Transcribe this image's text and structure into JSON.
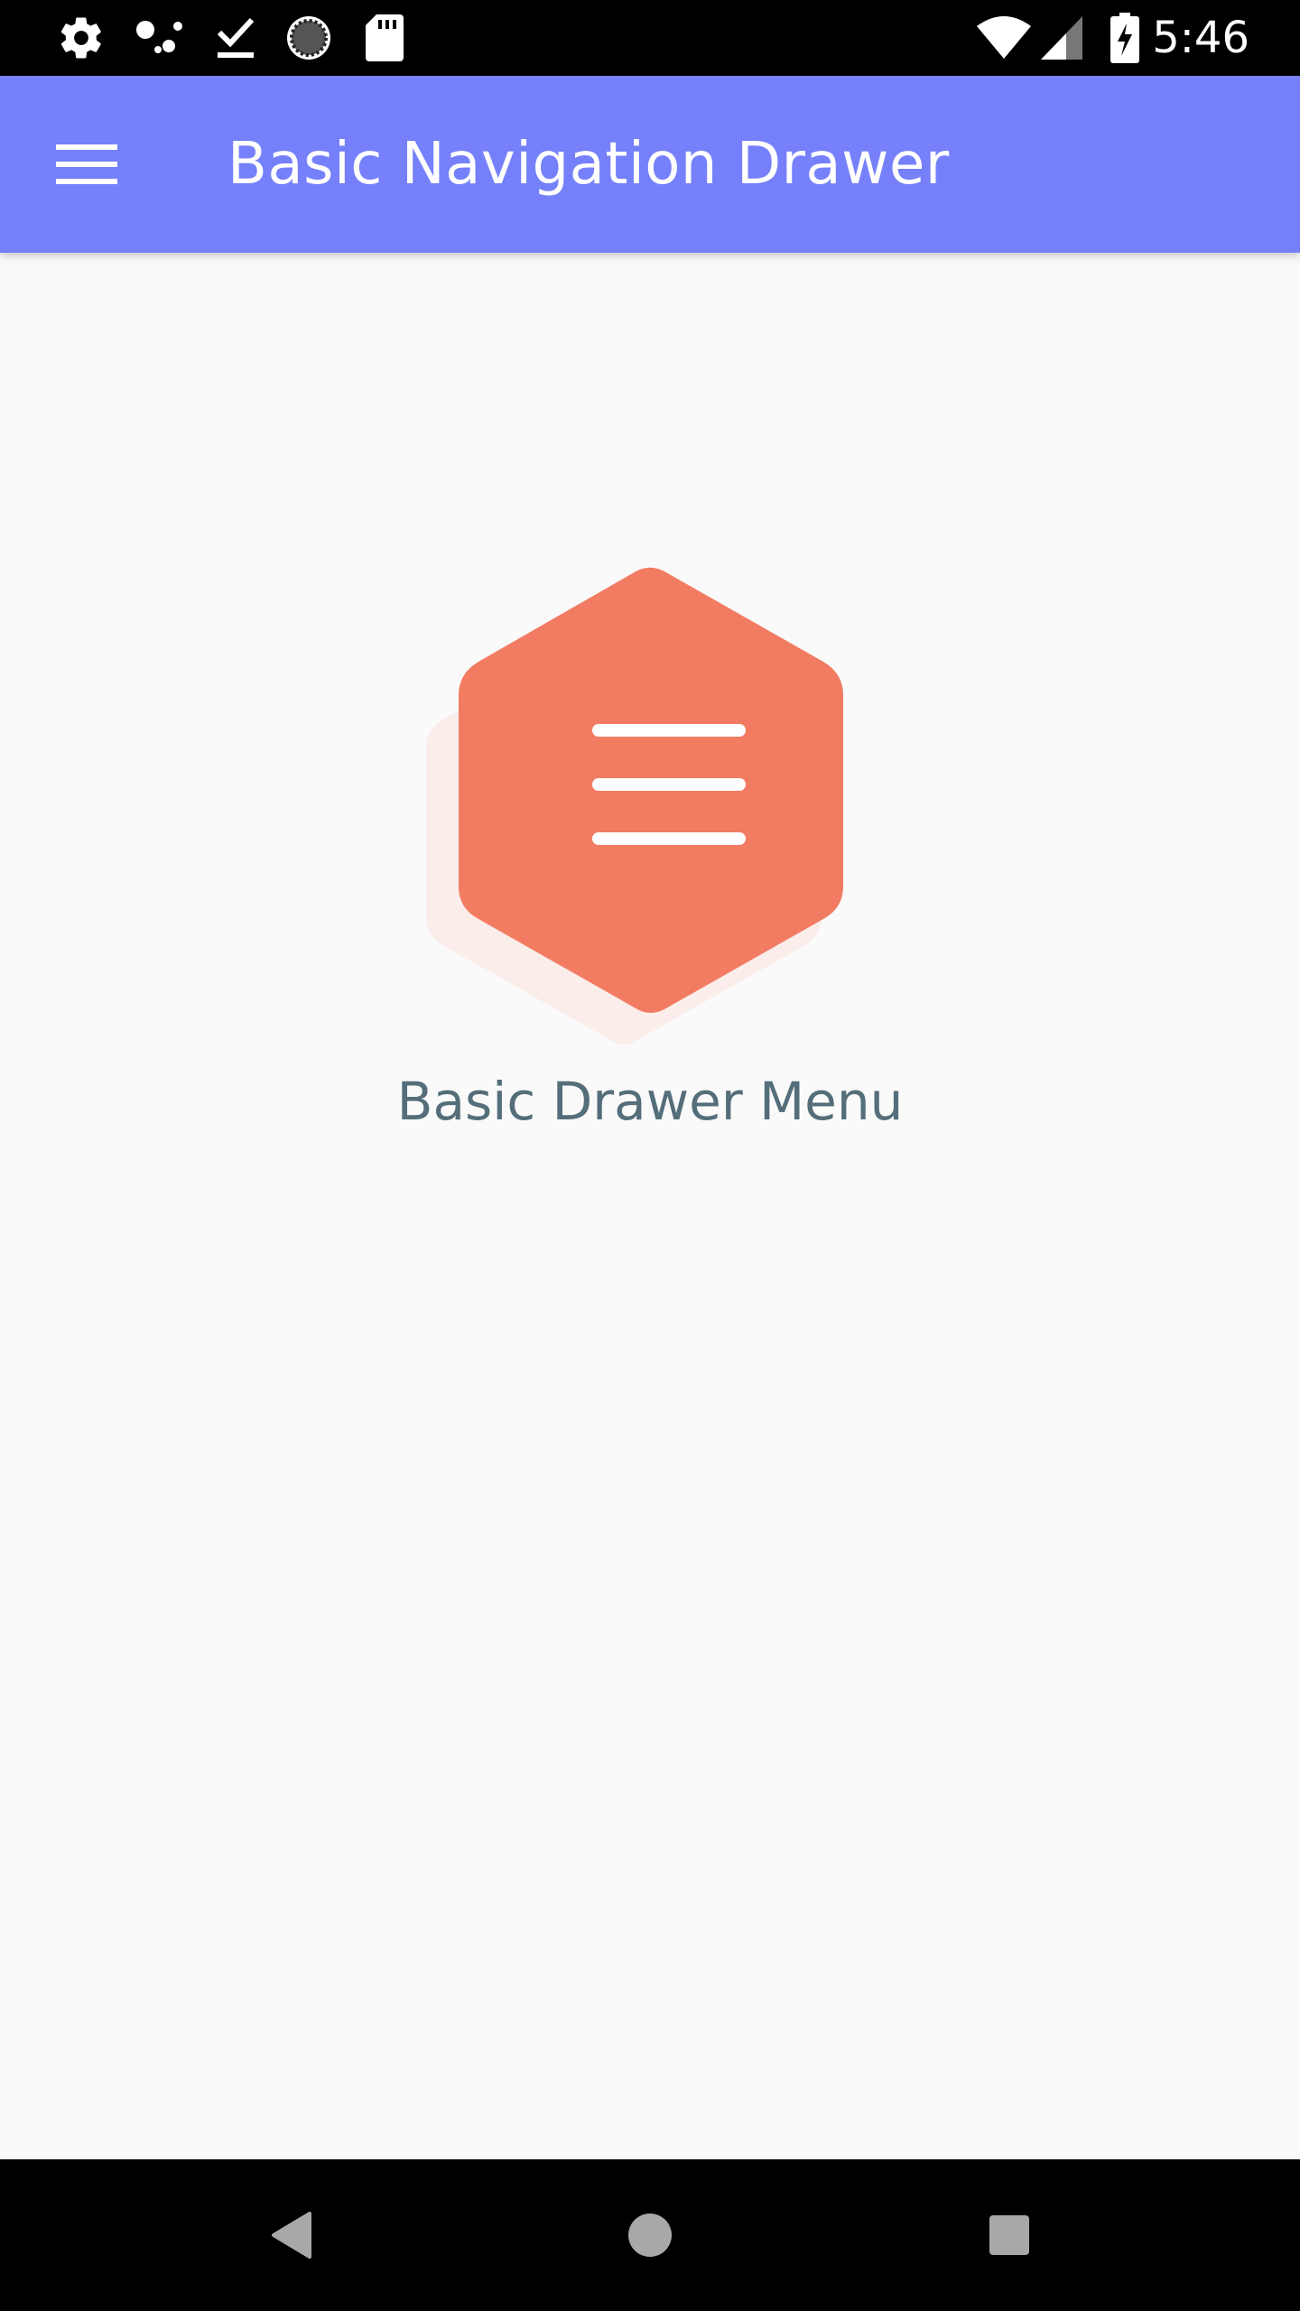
{
  "status_bar": {
    "time": "5:46",
    "left_icons": [
      "settings-icon",
      "assistant-dots-icon",
      "download-done-icon",
      "sync-progress-icon",
      "sd-card-icon"
    ],
    "right_icons": [
      "wifi-icon",
      "cell-signal-icon",
      "battery-charging-icon"
    ]
  },
  "app_bar": {
    "title": "Basic Navigation Drawer",
    "menu_icon": "hamburger-menu-icon",
    "color": "#7580fa"
  },
  "main": {
    "hero_icon": "hexagon-menu-icon",
    "hero_color": "#f27c62",
    "caption": "Basic Drawer Menu",
    "caption_color": "#546e7a"
  },
  "nav_bar": {
    "buttons": [
      "back-icon",
      "home-icon",
      "recents-icon"
    ]
  }
}
